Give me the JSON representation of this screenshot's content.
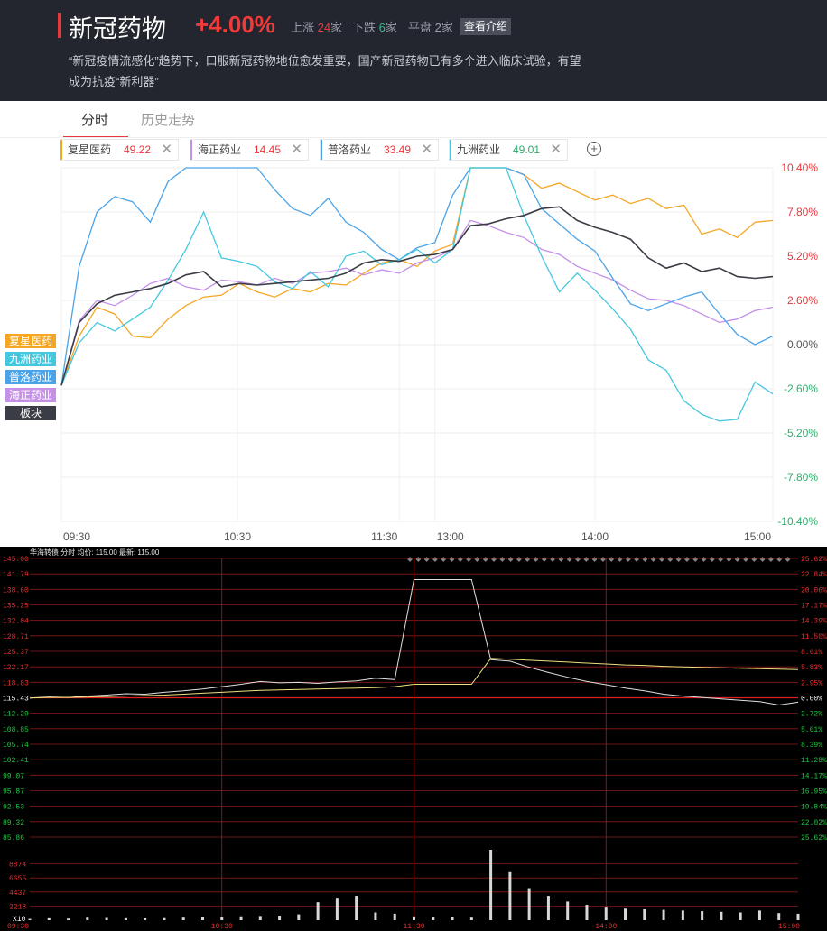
{
  "header": {
    "title": "新冠药物",
    "change": "+4.00%",
    "up_label": "上涨",
    "up_count": "24",
    "up_unit": "家",
    "down_label": "下跌",
    "down_count": "6",
    "down_unit": "家",
    "flat_label": "平盘",
    "flat_count": "2",
    "flat_unit": "家",
    "intro_button": "查看介绍",
    "description_line1": "“新冠疫情流感化”趋势下，口服新冠药物地位愈发重要，国产新冠药物已有多个进入临床试验，有望",
    "description_line2": "成为抗疫“新利器”"
  },
  "tabs": {
    "active": "分时",
    "inactive": "历史走势"
  },
  "legend": [
    {
      "name": "复星医药",
      "value": "49.22",
      "color": "#f5a623",
      "value_color": "#e8383d"
    },
    {
      "name": "海正药业",
      "value": "14.45",
      "color": "#c490e8",
      "value_color": "#e8383d"
    },
    {
      "name": "普洛药业",
      "value": "33.49",
      "color": "#4aa3e8",
      "value_color": "#e8383d"
    },
    {
      "name": "九洲药业",
      "value": "49.01",
      "color": "#44c8e0",
      "value_color": "#2dae6c"
    }
  ],
  "side_tags": [
    {
      "label": "复星医药",
      "color": "#f5a623"
    },
    {
      "label": "九洲药业",
      "color": "#44c8e0"
    },
    {
      "label": "普洛药业",
      "color": "#4aa3e8"
    },
    {
      "label": "海正药业",
      "color": "#c490e8"
    },
    {
      "label": "板块",
      "color": "#3a3d45"
    }
  ],
  "chart_data": [
    {
      "type": "line",
      "title": "",
      "x_labels": [
        "09:30",
        "10:30",
        "11:30",
        "13:00",
        "14:00",
        "15:00"
      ],
      "y_ticks": [
        "10.40%",
        "7.80%",
        "5.20%",
        "2.60%",
        "0.00%",
        "-2.60%",
        "-5.20%",
        "-7.80%",
        "-10.40%"
      ],
      "ylim": [
        -10.4,
        10.4
      ],
      "grid": true,
      "series": [
        {
          "name": "复星医药",
          "color": "#f5a623",
          "values": [
            -2.4,
            0.5,
            2.2,
            1.8,
            0.5,
            0.4,
            1.5,
            2.3,
            2.8,
            2.9,
            3.6,
            3.1,
            2.8,
            3.3,
            3.1,
            3.6,
            3.5,
            4.2,
            4.8,
            5.0,
            4.6,
            5.5,
            5.9,
            10.4,
            10.4,
            10.4,
            10.0,
            9.2,
            9.5,
            9.0,
            8.5,
            8.8,
            8.3,
            8.6,
            8.0,
            8.2,
            6.5,
            6.8,
            6.3,
            7.2,
            7.3
          ]
        },
        {
          "name": "海正药业",
          "color": "#c490e8",
          "values": [
            -2.4,
            1.4,
            2.6,
            2.3,
            2.9,
            3.6,
            3.9,
            3.4,
            3.2,
            3.8,
            3.7,
            3.5,
            3.9,
            3.6,
            4.2,
            4.3,
            4.5,
            4.1,
            4.4,
            4.2,
            4.8,
            5.1,
            5.6,
            7.3,
            7.0,
            6.6,
            6.3,
            5.6,
            5.3,
            4.6,
            4.2,
            3.8,
            3.2,
            2.7,
            2.6,
            2.3,
            1.8,
            1.3,
            1.5,
            2.0,
            2.2
          ]
        },
        {
          "name": "普洛药业",
          "color": "#4aa3e8",
          "values": [
            -2.4,
            4.6,
            7.8,
            8.7,
            8.4,
            7.2,
            9.6,
            10.4,
            10.4,
            10.4,
            10.4,
            10.4,
            9.1,
            8.0,
            7.6,
            8.6,
            7.2,
            6.6,
            5.6,
            5.0,
            5.7,
            6.0,
            8.8,
            10.4,
            10.4,
            10.4,
            10.0,
            8.0,
            7.1,
            6.2,
            5.5,
            3.9,
            2.4,
            2.0,
            2.4,
            2.8,
            3.1,
            1.8,
            0.6,
            0.0,
            0.5
          ]
        },
        {
          "name": "九洲药业",
          "color": "#44c8e0",
          "values": [
            -2.4,
            0.1,
            1.3,
            0.8,
            1.5,
            2.2,
            3.8,
            5.6,
            7.8,
            5.1,
            4.9,
            4.6,
            3.7,
            3.3,
            4.3,
            3.4,
            5.2,
            5.5,
            4.7,
            5.0,
            5.6,
            4.8,
            5.6,
            10.4,
            10.4,
            10.4,
            7.6,
            5.2,
            3.1,
            4.2,
            3.2,
            2.1,
            0.9,
            -0.9,
            -1.5,
            -3.3,
            -4.1,
            -4.5,
            -4.4,
            -2.2,
            -2.9
          ]
        },
        {
          "name": "板块",
          "color": "#3a3d45",
          "values": [
            -2.4,
            1.3,
            2.4,
            2.9,
            3.1,
            3.3,
            3.6,
            4.1,
            4.3,
            3.4,
            3.6,
            3.5,
            3.6,
            3.7,
            3.8,
            3.9,
            4.2,
            4.8,
            5.0,
            4.9,
            5.2,
            5.3,
            5.6,
            7.0,
            7.1,
            7.4,
            7.6,
            8.0,
            8.1,
            7.3,
            6.9,
            6.6,
            6.2,
            5.1,
            4.5,
            4.8,
            4.3,
            4.5,
            4.0,
            3.9,
            4.0
          ]
        }
      ]
    },
    {
      "type": "line",
      "title": "华海转债 分时 均价: 115.00 最新: 115.00",
      "price_ticks": [
        "145.00",
        "141.79",
        "138.60",
        "135.25",
        "132.04",
        "128.71",
        "125.37",
        "122.17",
        "118.83",
        "115.43",
        "112.29",
        "108.85",
        "105.74",
        "102.41",
        "99.07",
        "95.87",
        "92.53",
        "89.32",
        "85.86"
      ],
      "pct_ticks_up": [
        "25.62%",
        "22.84%",
        "20.06%",
        "17.17%",
        "14.39%",
        "11.50%",
        "8.61%",
        "5.83%",
        "2.95%"
      ],
      "pct_zero": "0.00%",
      "pct_ticks_down": [
        "2.72%",
        "5.61%",
        "8.39%",
        "11.28%",
        "14.17%",
        "16.95%",
        "19.84%",
        "22.02%",
        "25.62%"
      ],
      "volume_ticks": [
        "8874",
        "6655",
        "4437",
        "2218"
      ],
      "volume_unit": "X10",
      "x_labels": [
        "09:30",
        "10:30",
        "11:30",
        "14:00",
        "15:00"
      ],
      "ylim": [
        85.86,
        145.0
      ],
      "series": [
        {
          "name": "price",
          "color": "#e0e0e0",
          "values": [
            115.4,
            115.6,
            115.5,
            115.8,
            116.0,
            116.3,
            116.2,
            116.6,
            116.9,
            117.3,
            117.8,
            118.3,
            118.9,
            118.6,
            118.7,
            118.5,
            118.8,
            119.0,
            119.6,
            119.3,
            140.5,
            140.5,
            140.5,
            140.5,
            123.5,
            123.2,
            121.9,
            120.8,
            119.8,
            118.9,
            118.2,
            117.5,
            116.9,
            116.2,
            115.8,
            115.5,
            115.2,
            114.9,
            114.6,
            113.9,
            114.5
          ]
        },
        {
          "name": "avg",
          "color": "#f0e080",
          "values": [
            115.4,
            115.5,
            115.5,
            115.6,
            115.7,
            115.8,
            115.9,
            116.0,
            116.2,
            116.4,
            116.6,
            116.8,
            117.0,
            117.1,
            117.2,
            117.3,
            117.4,
            117.5,
            117.6,
            117.8,
            118.3,
            118.3,
            118.3,
            118.3,
            123.8,
            123.6,
            123.4,
            123.2,
            123.0,
            122.8,
            122.6,
            122.4,
            122.3,
            122.1,
            122.0,
            121.9,
            121.8,
            121.7,
            121.6,
            121.5,
            121.4
          ]
        }
      ],
      "volume": [
        200,
        300,
        250,
        400,
        350,
        300,
        280,
        320,
        400,
        500,
        450,
        600,
        650,
        700,
        900,
        2800,
        3500,
        3800,
        1200,
        1000,
        600,
        500,
        450,
        400,
        11000,
        7500,
        5000,
        3800,
        2900,
        2400,
        2100,
        1800,
        1700,
        1600,
        1500,
        1400,
        1300,
        1200,
        1500,
        1100,
        1000
      ]
    }
  ]
}
